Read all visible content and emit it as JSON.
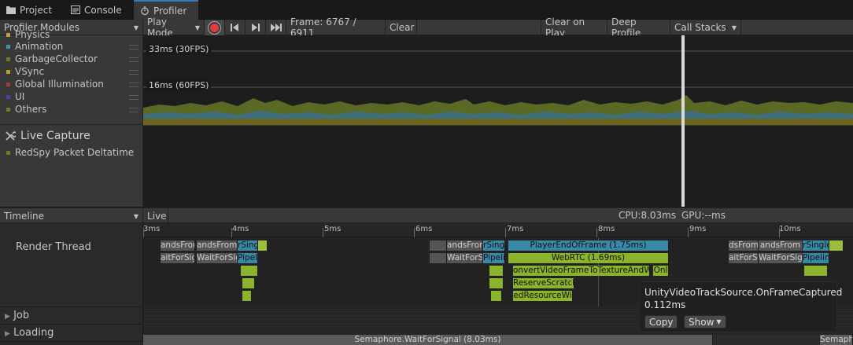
{
  "tabs": [
    {
      "label": "Project",
      "icon": "folder-icon",
      "active": false
    },
    {
      "label": "Console",
      "icon": "console-icon",
      "active": false
    },
    {
      "label": "Profiler",
      "icon": "stopwatch-icon",
      "active": true
    }
  ],
  "toolbar": {
    "modules_label": "Profiler Modules",
    "play_mode": "Play Mode",
    "frame": "Frame: 6767 / 6911",
    "clear": "Clear",
    "clear_on_play": "Clear on Play",
    "deep_profile": "Deep Profile",
    "call_stacks": "Call Stacks"
  },
  "modules": {
    "items": [
      {
        "label": "Physics",
        "color": "#d09a3a"
      },
      {
        "label": "Animation",
        "color": "#3f8fb0"
      },
      {
        "label": "GarbageCollector",
        "color": "#6a7a2a"
      },
      {
        "label": "VSync",
        "color": "#b8a21f"
      },
      {
        "label": "Global Illumination",
        "color": "#a03d2f"
      },
      {
        "label": "UI",
        "color": "#4a3f9e"
      },
      {
        "label": "Others",
        "color": "#6b7d2a"
      }
    ],
    "live_capture": "Live Capture",
    "live_items": [
      {
        "label": "RedSpy Packet Deltatime",
        "color": "#6b7d2a"
      }
    ]
  },
  "chart": {
    "line_30fps": "33ms (30FPS)",
    "line_60fps": "16ms (60FPS)"
  },
  "timeline": {
    "view_mode": "Timeline",
    "live": "Live",
    "cpu": "CPU:8.03ms",
    "gpu": "GPU:--ms",
    "ticks": [
      "3ms",
      "4ms",
      "5ms",
      "6ms",
      "7ms",
      "8ms",
      "9ms",
      "10ms"
    ]
  },
  "threads": {
    "render": "Render Thread",
    "job": "Job",
    "loading": "Loading"
  },
  "blocks": {
    "a1": "andsFrom",
    "a2": "andsFrom",
    "a3": "rSingle",
    "b1": "aitForSig",
    "b2": "WaitForSig",
    "b3": "Pipeli",
    "c1": "andsFrom",
    "c2": "rSingle",
    "c3": "PlayerEndOfFrame (1.75ms)",
    "d1": "WaitForSig",
    "d2": "Pipeli",
    "d3": "WebRTC (1.69ms)",
    "e1": "onvertVideoFrameToTextureAndW",
    "e2": "Onl",
    "f1": "ReserveScratch",
    "g1": "edResourceWi",
    "h1": "dsFrom",
    "h2": "andsFrom",
    "h3": "rSingleC",
    "i1": "aitForSig",
    "i2": "WaitForSig",
    "i3": "Pipeline",
    "semaphore": "Semaphore.WaitForSignal (8.03ms)",
    "semaphore2": "Semaph"
  },
  "tooltip": {
    "title": "UnityVideoTrackSource.OnFrameCaptured",
    "duration": "0.112ms",
    "copy": "Copy",
    "show": "Show"
  }
}
